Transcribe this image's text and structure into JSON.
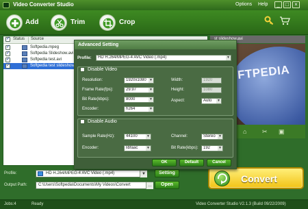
{
  "app": {
    "title": "Video Converter Studio",
    "menu": [
      "Options",
      "Help"
    ],
    "window_buttons": [
      "_",
      "□",
      "×"
    ]
  },
  "toolbar": {
    "add_label": "Add",
    "trim_label": "Trim",
    "crop_label": "Crop"
  },
  "file_list": {
    "columns": [
      "Status",
      "Source"
    ],
    "rows": [
      {
        "name": "Softpedia.mpeg",
        "checked": true,
        "selected": false
      },
      {
        "name": "Softpedia Slideshow.avi",
        "checked": true,
        "selected": false
      },
      {
        "name": "Softpedia test.avi",
        "checked": true,
        "selected": false
      },
      {
        "name": "Softpedia test slideshow",
        "checked": true,
        "selected": true
      }
    ]
  },
  "preview": {
    "title": "st slideshow.avi",
    "overlay_text": "FTPEDIA"
  },
  "dialog": {
    "title": "Advanced Setting",
    "profile_label": "Profile:",
    "profile_value": "HD H.264/MPEG-4 AVC Video (.mp4)",
    "video": {
      "disable_label": "Disable Video",
      "resolution_label": "Resolution:",
      "resolution_value": "1920x1080",
      "framerate_label": "Frame Rate(fps):",
      "framerate_value": "29.97",
      "bitrate_label": "Bit Rate(kbps):",
      "bitrate_value": "8000",
      "encoder_label": "Encoder:",
      "encoder_value": "h264",
      "width_label": "Width:",
      "width_value": "1920",
      "height_label": "Height:",
      "height_value": "1080",
      "aspect_label": "Aspect:",
      "aspect_value": "Auto"
    },
    "audio": {
      "disable_label": "Disable Audio",
      "samplerate_label": "Sample Rate(Hz):",
      "samplerate_value": "44100",
      "encoder_label": "Encoder:",
      "encoder_value": "libfaac",
      "channel_label": "Channel:",
      "channel_value": "Stereo",
      "bitrate_label": "Bit Rate(kbps):",
      "bitrate_value": "192"
    },
    "ok_label": "OK",
    "default_label": "Default",
    "cancel_label": "Cancel"
  },
  "bottom": {
    "profile_label": "Profile:",
    "profile_value": "HD H.264/MPEG-4 AVC Video (.mp4)",
    "setting_label": "Setting",
    "output_label": "Output Path:",
    "output_value": "C:\\Users\\Softpedia\\Documents\\My Videos\\Convert",
    "open_label": "Open",
    "convert_label": "Convert"
  },
  "status": {
    "jobs": "Jobs:4",
    "state": "Ready",
    "version": "Video Converter Studio V2.1.3 (Build 09/22/2009)"
  },
  "colors": {
    "background": "#2f6d2a",
    "toolbar": "#3e8a22",
    "accent_button": "#f2c316",
    "selection": "#2f6fd6"
  }
}
